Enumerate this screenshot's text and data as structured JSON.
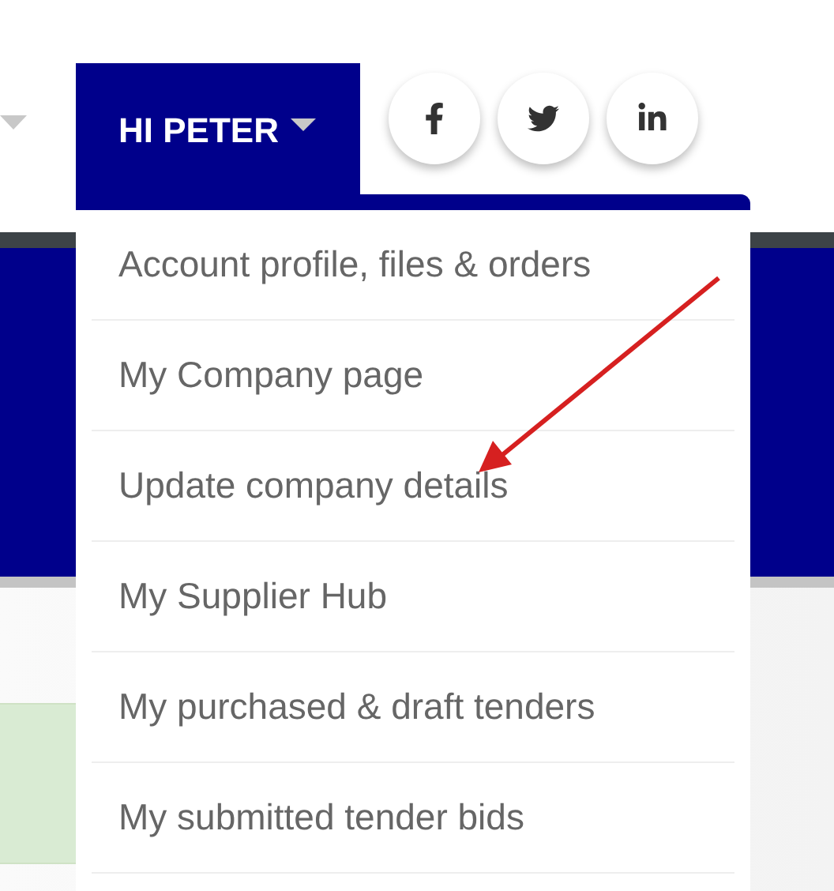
{
  "account_menu": {
    "greeting": "HI PETER",
    "items": [
      {
        "label": "Account profile, files & orders"
      },
      {
        "label": "My Company page"
      },
      {
        "label": "Update company details"
      },
      {
        "label": "My Supplier Hub"
      },
      {
        "label": "My purchased & draft tenders"
      },
      {
        "label": "My submitted tender bids"
      }
    ]
  }
}
